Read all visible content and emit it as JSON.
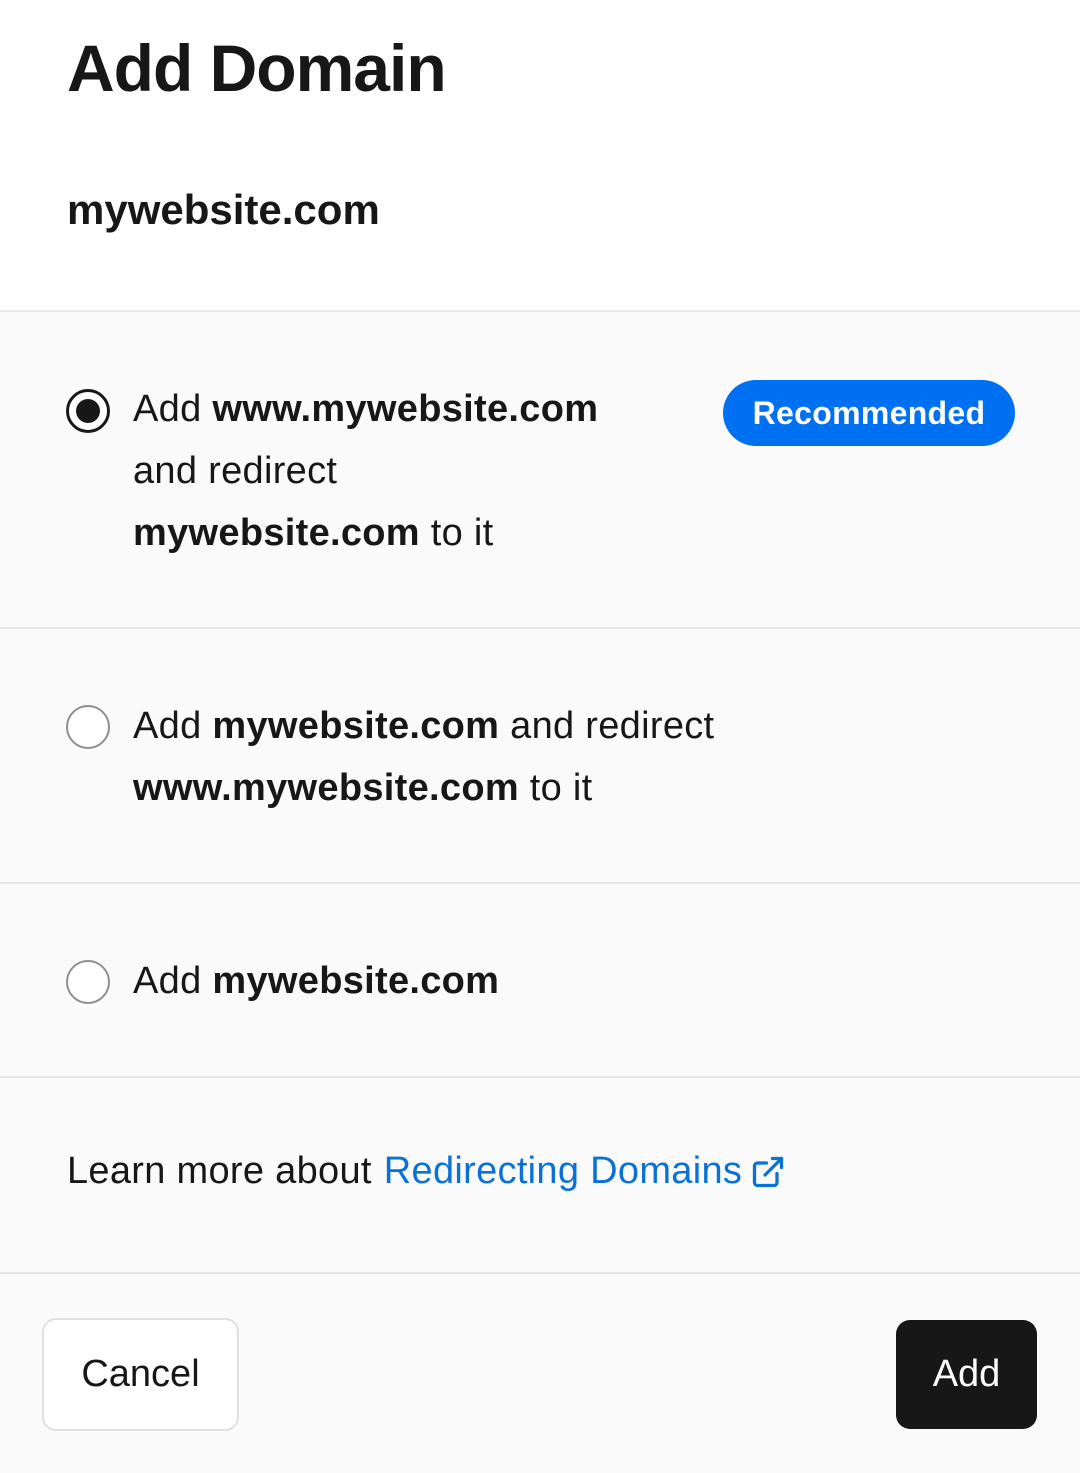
{
  "dialog": {
    "title": "Add Domain",
    "domain": "mywebsite.com"
  },
  "options": [
    {
      "selected": true,
      "parts": [
        "Add ",
        "www.mywebsite.com",
        "and redirect",
        "mywebsite.com",
        " to it"
      ],
      "badge": "Recommended"
    },
    {
      "selected": false,
      "parts": [
        "Add ",
        "mywebsite.com",
        " and redirect",
        "www.mywebsite.com",
        " to it"
      ]
    },
    {
      "selected": false,
      "parts": [
        "Add ",
        "mywebsite.com"
      ]
    }
  ],
  "learn_more": {
    "prefix": "Learn more about",
    "link_text": "Redirecting Domains",
    "icon": "external-link-icon"
  },
  "buttons": {
    "cancel": "Cancel",
    "add": "Add"
  },
  "colors": {
    "badge": "#0070f3",
    "link": "#0a72d6",
    "primary_button": "#171717"
  }
}
